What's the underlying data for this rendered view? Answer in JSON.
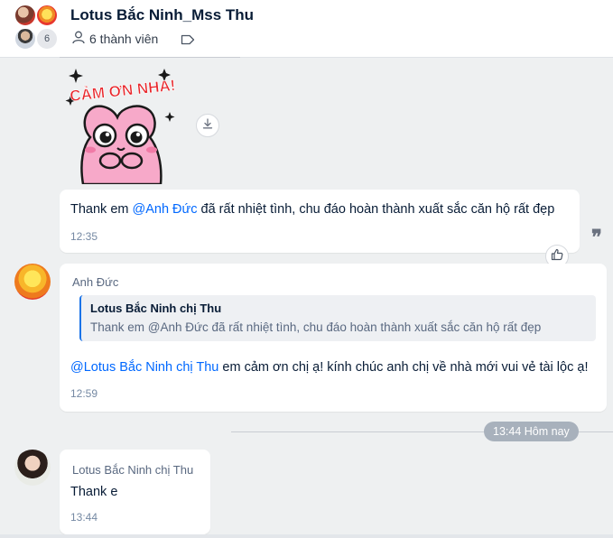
{
  "header": {
    "title": "Lotus Bắc Ninh_Mss Thu",
    "member_count_badge": "6",
    "members_label": "6 thành viên"
  },
  "messages": [
    {
      "type": "sticker",
      "sticker_text": "CẢM ƠN NHA!"
    },
    {
      "type": "text",
      "text_before": "Thank em ",
      "mention": "@Anh Đức",
      "text_after": "  đã rất nhiệt tình, chu đáo hoàn thành xuất sắc căn hộ rất đẹp",
      "time": "12:35"
    },
    {
      "type": "reply",
      "sender": "Anh Đức",
      "quoted_name": "Lotus Bắc Ninh chị Thu",
      "quoted_text": "Thank em @Anh Đức đã rất nhiệt tình, chu đáo hoàn thành xuất sắc căn hộ rất đẹp",
      "mention": "@Lotus Bắc Ninh chị Thu",
      "text_after": " em cảm ơn chị ạ! kính chúc anh chị về nhà mới vui vẻ tài lộc ạ!",
      "time": "12:59"
    },
    {
      "type": "text",
      "sender": "Lotus Bắc Ninh chị Thu",
      "text": "Thank e",
      "time": "13:44"
    }
  ],
  "date_separator": "13:44 Hôm nay",
  "icons": {
    "members": "person-icon",
    "tag": "tag-icon",
    "download": "download-icon",
    "quote": "quote-icon",
    "like": "thumbs-up-icon"
  },
  "colors": {
    "accent": "#0068ff",
    "background": "#eef0f1",
    "bubble": "#ffffff"
  }
}
